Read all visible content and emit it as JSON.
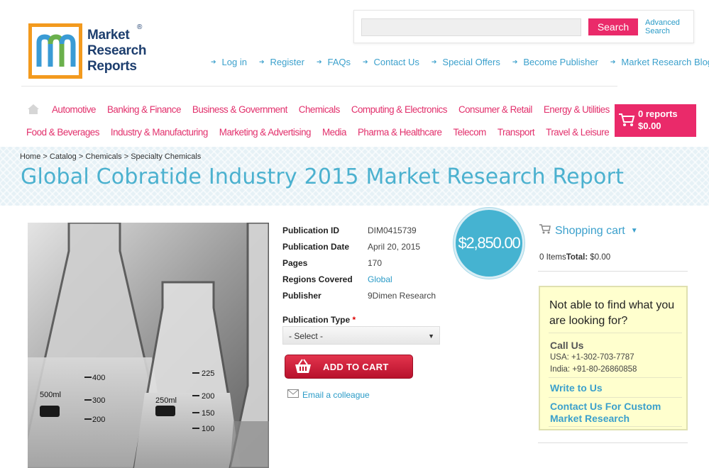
{
  "logo": {
    "line1": "Market",
    "line2": "Research",
    "line3": "Reports",
    "reg": "®"
  },
  "search": {
    "placeholder": "",
    "button_label": "Search",
    "advanced_line1": "Advanced",
    "advanced_line2": "Search"
  },
  "top_nav": [
    "Log in",
    "Register",
    "FAQs",
    "Contact Us",
    "Special Offers",
    "Become Publisher",
    "Market Research Blog"
  ],
  "categories_row1": [
    "Automotive",
    "Banking & Finance",
    "Business & Government",
    "Chemicals",
    "Computing & Electronics",
    "Consumer & Retail",
    "Energy & Utilities"
  ],
  "categories_row2": [
    "Food & Beverages",
    "Industry & Manufacturing",
    "Marketing & Advertising",
    "Media",
    "Pharma & Healthcare",
    "Telecom",
    "Transport",
    "Travel & Leisure"
  ],
  "cart_button": {
    "count": "0 reports",
    "total": "$0.00"
  },
  "breadcrumb": "Home > Catalog > Chemicals > Specialty Chemicals",
  "title": "Global Cobratide Industry 2015 Market Research Report",
  "details": {
    "id_label": "Publication ID",
    "id_value": "DIM0415739",
    "date_label": "Publication Date",
    "date_value": "April 20, 2015",
    "pages_label": "Pages",
    "pages_value": "170",
    "regions_label": "Regions Covered",
    "regions_value": "Global",
    "publisher_label": "Publisher",
    "publisher_value": "9Dimen Research"
  },
  "publication_type": {
    "label": "Publication Type",
    "required": "*",
    "selected": "- Select -"
  },
  "add_to_cart": "ADD TO CART",
  "email_colleague": "Email a colleague",
  "price": "$2,850.00",
  "shopping_cart": {
    "title": "Shopping cart",
    "items": "0 Items",
    "total_label": "Total:",
    "total_value": "$0.00"
  },
  "help": {
    "title": "Not able to find what you are looking for?",
    "call_us": "Call Us",
    "usa": "USA: +1-302-703-7787",
    "india": "India: +91-80-26860858",
    "write_us": "Write to Us",
    "contact_custom": "Contact Us For Custom Market Research"
  },
  "colors": {
    "accent_pink": "#ea2a6a",
    "link_blue": "#3ba0cc",
    "title_blue": "#4bb1cf",
    "price_circle": "#45b3d1",
    "help_bg": "#ffffce"
  },
  "image_marks": {
    "flask1_ticks": [
      "400",
      "300",
      "200"
    ],
    "flask1_label": "500ml",
    "flask2_ticks": [
      "225",
      "200",
      "150",
      "100"
    ],
    "flask2_label": "250ml"
  }
}
